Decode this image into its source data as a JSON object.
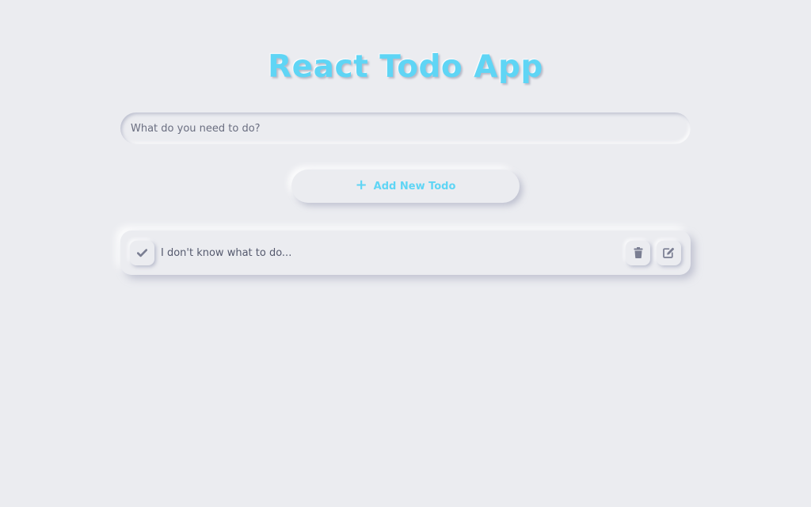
{
  "header": {
    "title": "React Todo App"
  },
  "input": {
    "placeholder": "What do you need to do?",
    "value": ""
  },
  "add_button": {
    "icon": "plus-icon",
    "label": "Add New Todo"
  },
  "todos": [
    {
      "text": "I don't know what to do...",
      "completed": false,
      "complete_icon": "check-icon",
      "delete_icon": "trash-icon",
      "edit_icon": "edit-icon"
    }
  ],
  "colors": {
    "accent": "#5fd5f5",
    "background": "#ebecf0",
    "text": "#555a6e",
    "icon": "#7a7e92"
  }
}
